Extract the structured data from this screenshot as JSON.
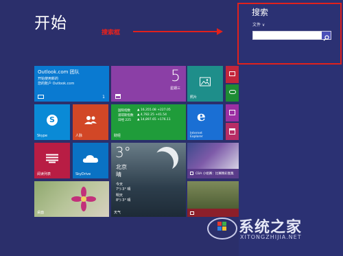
{
  "start": {
    "title": "开始"
  },
  "annotation": {
    "label": "搜索框"
  },
  "search": {
    "title": "搜索",
    "scope": "文件 ∨",
    "input_value": "",
    "placeholder": ""
  },
  "tiles": {
    "outlook": {
      "title": "Outlook.com 团队",
      "line1": "开始使用新的",
      "line2": "您的账户 Outlook.com",
      "badge": "1"
    },
    "calendar": {
      "number": "5",
      "day": "星期三"
    },
    "photos": {
      "label": "照片"
    },
    "skype": {
      "label": "Skype"
    },
    "people": {
      "label": "人脉"
    },
    "finance": {
      "label": "财经",
      "rows": [
        {
          "name": "国际指数",
          "value": "▲ 16,355.08 +227.05"
        },
        {
          "name": "道琼斯指数",
          "value": "▲ 4,782.25 +41.54"
        },
        {
          "name": "日经 225",
          "value": "▲ 14,897.65 +176.11"
        }
      ]
    },
    "ie": {
      "label": "Internet Explorer"
    },
    "reading": {
      "label": "阅读列表"
    },
    "skydrive": {
      "label": "SkyDrive"
    },
    "weather": {
      "temp": "3°",
      "city": "北京",
      "cond": "晴",
      "row1": "今天",
      "row2": "7°/-3° 晴",
      "row3": "明天",
      "row4": "8°/-3° 晴",
      "label": "天气"
    },
    "sports": {
      "label": "CBA 小组赛：比赛精彩图集"
    },
    "desktop": {
      "label": "桌面"
    }
  },
  "watermark": {
    "text": "系统之家",
    "url": "XITONGZHIJIA.NET"
  },
  "colors": {
    "background": "#2b2f6b",
    "accent_red": "#e2211c",
    "search_pane": "#2b3173"
  }
}
